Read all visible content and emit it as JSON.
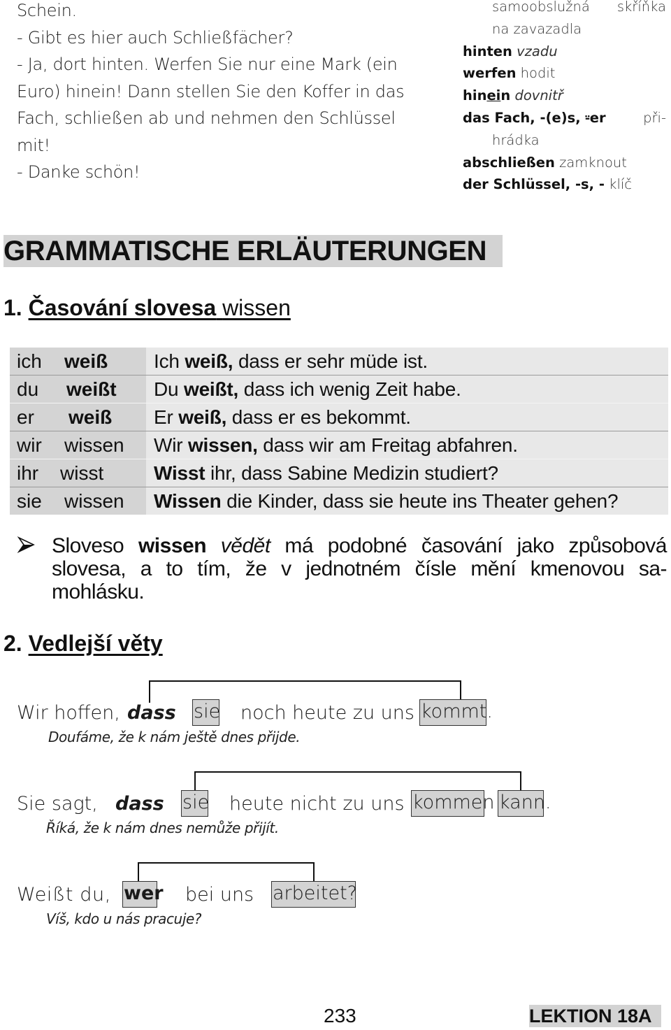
{
  "dialogue": {
    "lines": [
      "Schein.",
      "- Gibt es hier auch Schließfächer?",
      "- Ja, dort hinten. Werfen Sie nur eine Mark (ein",
      "Euro) hinein! Dann stellen Sie den Koffer in das",
      "Fach, schließen ab und nehmen den Schlüssel",
      "mit!",
      "- Danke schön!"
    ]
  },
  "vocabulary": {
    "continued": {
      "line1_left": "samoobslužná",
      "line1_right": "skříňka",
      "line2": "na zavazadla"
    },
    "entries": [
      {
        "term": "hinten",
        "translation": "vzadu"
      },
      {
        "term": "werfen",
        "translation": "hodit"
      },
      {
        "term_pre": "hin",
        "term_underlined": "ei",
        "term_post": "n",
        "translation": "dovnitř"
      },
      {
        "term": "das Fach, -(e)s, ⸚er",
        "translation": "při-",
        "translation_cont": "hrádka"
      },
      {
        "term": "abschließen",
        "translation": "zamknout"
      },
      {
        "term": "der Schlüssel, -s, -",
        "translation": "klíč"
      }
    ]
  },
  "main_heading": "GRAMMATISCHE ERLÄUTERUNGEN",
  "section1": {
    "number": "1.",
    "title_bold": "Časování slovesa",
    "title_normal": "wissen"
  },
  "conjugation_table": {
    "rows": [
      {
        "pronoun": "ich",
        "verb": "weiß",
        "verb_bold": true,
        "example": [
          {
            "t": "Ich ",
            "b": false
          },
          {
            "t": "weiß,",
            "b": true
          },
          {
            "t": " dass er sehr müde ist.",
            "b": false
          }
        ]
      },
      {
        "pronoun": "du",
        "verb": "weißt",
        "verb_bold": true,
        "example": [
          {
            "t": "Du ",
            "b": false
          },
          {
            "t": "weißt,",
            "b": true
          },
          {
            "t": " dass ich wenig Zeit habe.",
            "b": false
          }
        ]
      },
      {
        "pronoun": "er",
        "verb": "weiß",
        "verb_bold": true,
        "example": [
          {
            "t": "Er ",
            "b": false
          },
          {
            "t": "weiß,",
            "b": true
          },
          {
            "t": " dass er es bekommt.",
            "b": false
          }
        ]
      },
      {
        "pronoun": "wir",
        "verb": "wissen",
        "verb_bold": false,
        "example": [
          {
            "t": "Wir ",
            "b": false
          },
          {
            "t": "wissen,",
            "b": true
          },
          {
            "t": " dass wir am Freitag abfahren.",
            "b": false
          }
        ]
      },
      {
        "pronoun": "ihr",
        "verb": "wisst",
        "verb_bold": false,
        "example": [
          {
            "t": "Wisst",
            "b": true
          },
          {
            "t": " ihr, dass Sabine Medizin studiert?",
            "b": false
          }
        ]
      },
      {
        "pronoun": "sie",
        "verb": "wissen",
        "verb_bold": false,
        "example": [
          {
            "t": "Wissen",
            "b": true
          },
          {
            "t": " die Kinder, dass sie heute ins Theater gehen?",
            "b": false
          }
        ]
      }
    ]
  },
  "note": {
    "bullet_icon": "arrowhead-bullet",
    "line1": {
      "pre": "Sloveso ",
      "bold": "wissen",
      "italic": " vědět",
      "post": " má podobné časování jako způsobová"
    },
    "line2": "slovesa, a to tím, že v jednotném čísle mění kmenovou sa-",
    "line3": "mohlásku."
  },
  "section2": {
    "number": "2.",
    "title": "Vedlejší věty"
  },
  "diagrams": [
    {
      "main_clause": "Wir hoffen,",
      "conjunction": "dass",
      "subject": "sie",
      "middle": "noch heute zu uns",
      "verbs": [
        "kommt."
      ],
      "translation": "Doufáme, že k nám ještě dnes přijde."
    },
    {
      "main_clause": "Sie sagt,",
      "conjunction": "dass",
      "subject": "sie",
      "middle": "heute nicht zu uns",
      "verbs": [
        "kommen",
        "kann."
      ],
      "translation": "Říká, že k nám dnes nemůže přijít."
    },
    {
      "main_clause": "Weißt  du,",
      "subject": "wer",
      "middle": "bei uns",
      "verbs": [
        "arbeitet?"
      ],
      "translation": "Víš, kdo u nás pracuje?"
    }
  ],
  "footer": {
    "page_number": "233",
    "lesson": "LEKTION 18A"
  }
}
